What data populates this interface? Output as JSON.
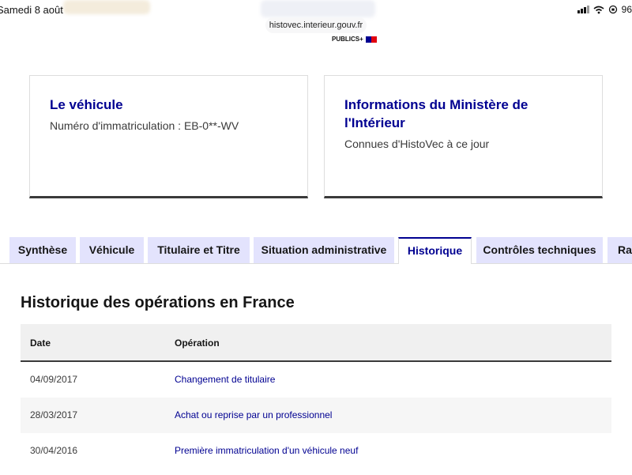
{
  "status_bar": {
    "time": "Samedi 8 août",
    "battery": "96"
  },
  "browser": {
    "url": "histovec.interieur.gouv.fr",
    "brand": "PUBLICS+"
  },
  "cards": [
    {
      "title": "Le véhicule",
      "subtitle": "Numéro d'immatriculation : EB-0**-WV"
    },
    {
      "title_line1": "Informations du Ministère de",
      "title_line2": "l'Intérieur",
      "subtitle": "Connues d'HistoVec à ce jour"
    }
  ],
  "tabs": [
    {
      "label": "Synthèse",
      "active": false
    },
    {
      "label": "Véhicule",
      "active": false
    },
    {
      "label": "Titulaire et Titre",
      "active": false
    },
    {
      "label": "Situation administrative",
      "active": false
    },
    {
      "label": "Historique",
      "active": true
    },
    {
      "label": "Contrôles techniques",
      "active": false
    },
    {
      "label": "Rap",
      "active": false
    }
  ],
  "history": {
    "heading": "Historique des opérations en France",
    "columns": [
      "Date",
      "Opération"
    ],
    "rows": [
      {
        "date": "04/09/2017",
        "operation": "Changement de titulaire"
      },
      {
        "date": "28/03/2017",
        "operation": "Achat ou reprise par un professionnel"
      },
      {
        "date": "30/04/2016",
        "operation": "Première immatriculation d'un véhicule neuf"
      }
    ]
  },
  "colors": {
    "accent": "#000091",
    "tab_background": "#e3e3fd",
    "text": "#161616"
  }
}
